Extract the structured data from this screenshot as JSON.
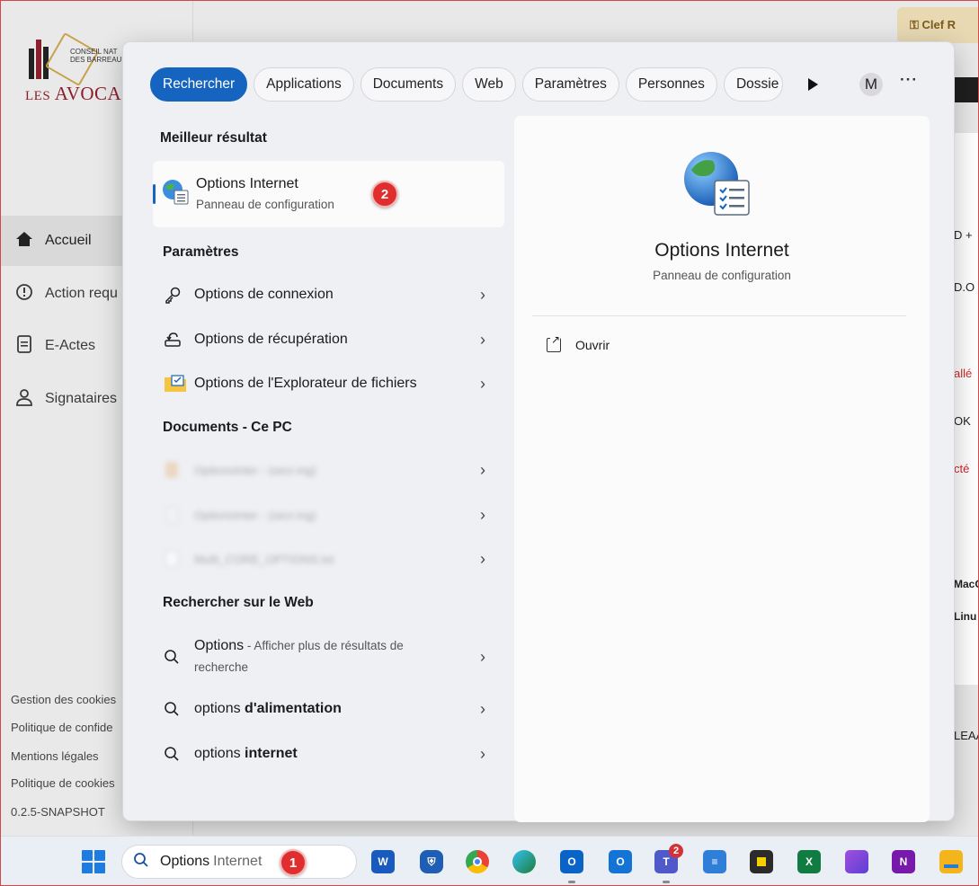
{
  "background_app": {
    "logo_small_line1": "CONSEIL NAT",
    "logo_small_line2": "DES BARREAU",
    "logo_big_les": "LES",
    "logo_big_name": "AVOCA",
    "nav": [
      {
        "label": "Accueil",
        "icon": "home-icon"
      },
      {
        "label": "Action requ",
        "icon": "alert-circle-icon"
      },
      {
        "label": "E-Actes",
        "icon": "document-icon"
      },
      {
        "label": "Signataires",
        "icon": "user-icon"
      }
    ],
    "footer_links": [
      "Gestion des cookies",
      "Politique de confide",
      "Mentions légales",
      "Politique de cookies",
      "0.2.5-SNAPSHOT"
    ],
    "top_right_label": "Clef R",
    "fragments": [
      "D +",
      "D.O",
      "allé",
      "OK",
      "cté",
      "MacO",
      "Linu",
      "LEAA"
    ]
  },
  "search_panel": {
    "filters": [
      "Rechercher",
      "Applications",
      "Documents",
      "Web",
      "Paramètres",
      "Personnes",
      "Dossie"
    ],
    "active_filter": "Rechercher",
    "avatar_letter": "M",
    "more_label": "···",
    "sections": {
      "best": "Meilleur résultat",
      "settings": "Paramètres",
      "documents": "Documents - Ce PC",
      "web": "Rechercher sur le Web"
    },
    "best_result": {
      "title": "Options Internet",
      "subtitle": "Panneau de configuration",
      "icon": "internet-options-icon",
      "badge": "2"
    },
    "settings_items": [
      {
        "label": "Options de connexion",
        "icon": "key-icon"
      },
      {
        "label": "Options de récupération",
        "icon": "recovery-icon"
      },
      {
        "label": "Options de l'Explorateur de fichiers",
        "icon": "folder-options-icon"
      }
    ],
    "document_items": [
      {
        "label": "OptionsInter - (secr.ing)"
      },
      {
        "label": "OptionsInter - (secr.ing)"
      },
      {
        "label": "Multi_CORE_OPTIONS.txt"
      }
    ],
    "web_items": [
      {
        "main": "Options",
        "suffix": " - Afficher plus de résultats de",
        "line2": "recherche"
      },
      {
        "normal": "options ",
        "bold": "d'alimentation"
      },
      {
        "normal": "options ",
        "bold": "internet"
      }
    ],
    "detail": {
      "title": "Options Internet",
      "subtitle": "Panneau de configuration",
      "open_label": "Ouvrir"
    }
  },
  "taskbar": {
    "search_typed": "Options",
    "search_rest": "Internet",
    "search_badge": "1",
    "teams_badge": "2",
    "apps": [
      "word-icon",
      "defender-icon",
      "chrome-icon",
      "edge-icon",
      "outlook-icon",
      "outlook-new-icon",
      "teams-icon",
      "notepad-icon",
      "sticky-notes-icon",
      "excel-icon",
      "clipchamp-icon",
      "onenote-icon",
      "file-explorer-icon"
    ]
  }
}
